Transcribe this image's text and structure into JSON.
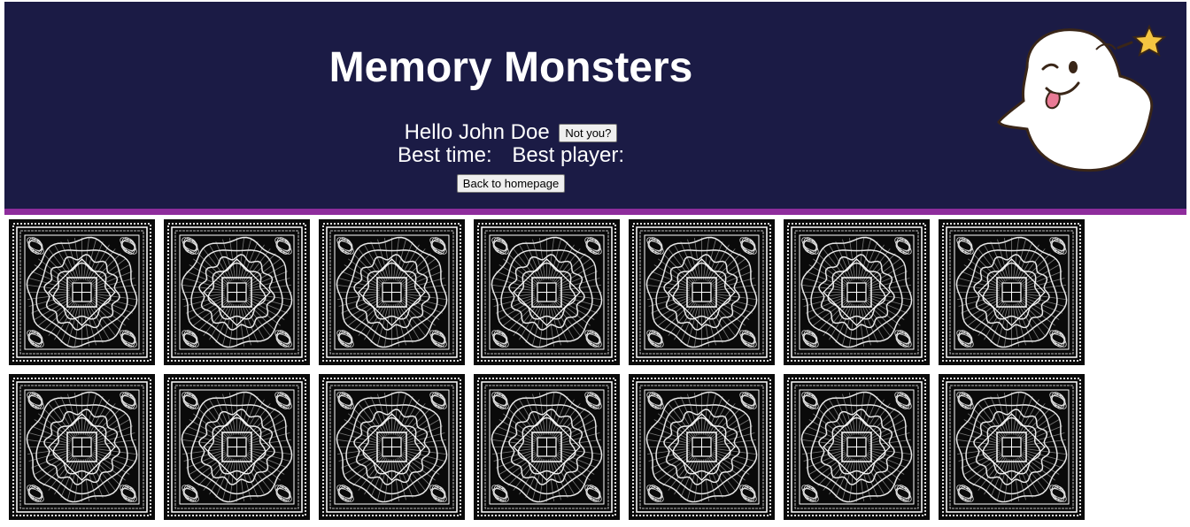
{
  "header": {
    "title": "Memory Monsters",
    "greeting": "Hello John Doe",
    "not_you_label": "Not you?",
    "best_time_label": "Best time:",
    "best_player_label": "Best player:",
    "back_home_label": "Back to homepage",
    "mascot_icon": "winking-ghost-with-star-icon"
  },
  "colors": {
    "header_bg": "#1b1b45",
    "accent_stripe": "#8e2c9c",
    "card_bg": "#0a0a0a"
  },
  "board": {
    "rows": 2,
    "columns": 7,
    "cards": [
      {
        "state": "face-down",
        "back_icon": "mandala-pattern-icon"
      },
      {
        "state": "face-down",
        "back_icon": "mandala-pattern-icon"
      },
      {
        "state": "face-down",
        "back_icon": "mandala-pattern-icon"
      },
      {
        "state": "face-down",
        "back_icon": "mandala-pattern-icon"
      },
      {
        "state": "face-down",
        "back_icon": "mandala-pattern-icon"
      },
      {
        "state": "face-down",
        "back_icon": "mandala-pattern-icon"
      },
      {
        "state": "face-down",
        "back_icon": "mandala-pattern-icon"
      },
      {
        "state": "face-down",
        "back_icon": "mandala-pattern-icon"
      },
      {
        "state": "face-down",
        "back_icon": "mandala-pattern-icon"
      },
      {
        "state": "face-down",
        "back_icon": "mandala-pattern-icon"
      },
      {
        "state": "face-down",
        "back_icon": "mandala-pattern-icon"
      },
      {
        "state": "face-down",
        "back_icon": "mandala-pattern-icon"
      },
      {
        "state": "face-down",
        "back_icon": "mandala-pattern-icon"
      },
      {
        "state": "face-down",
        "back_icon": "mandala-pattern-icon"
      }
    ]
  }
}
